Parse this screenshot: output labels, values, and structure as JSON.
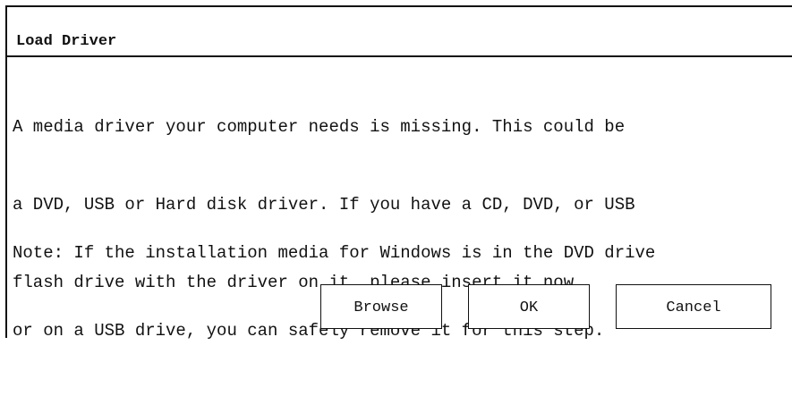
{
  "dialog": {
    "title": "Load Driver",
    "message_lines": [
      "A media driver your computer needs is missing. This could be",
      "a DVD, USB or Hard disk driver. If you have a CD, DVD, or USB",
      "flash drive with the driver on it, please insert it now."
    ],
    "note_lines": [
      "Note: If the installation media for Windows is in the DVD drive",
      "or on a USB drive, you can safely remove it for this step."
    ],
    "buttons": {
      "browse": "Browse",
      "ok": "OK",
      "cancel": "Cancel"
    }
  }
}
